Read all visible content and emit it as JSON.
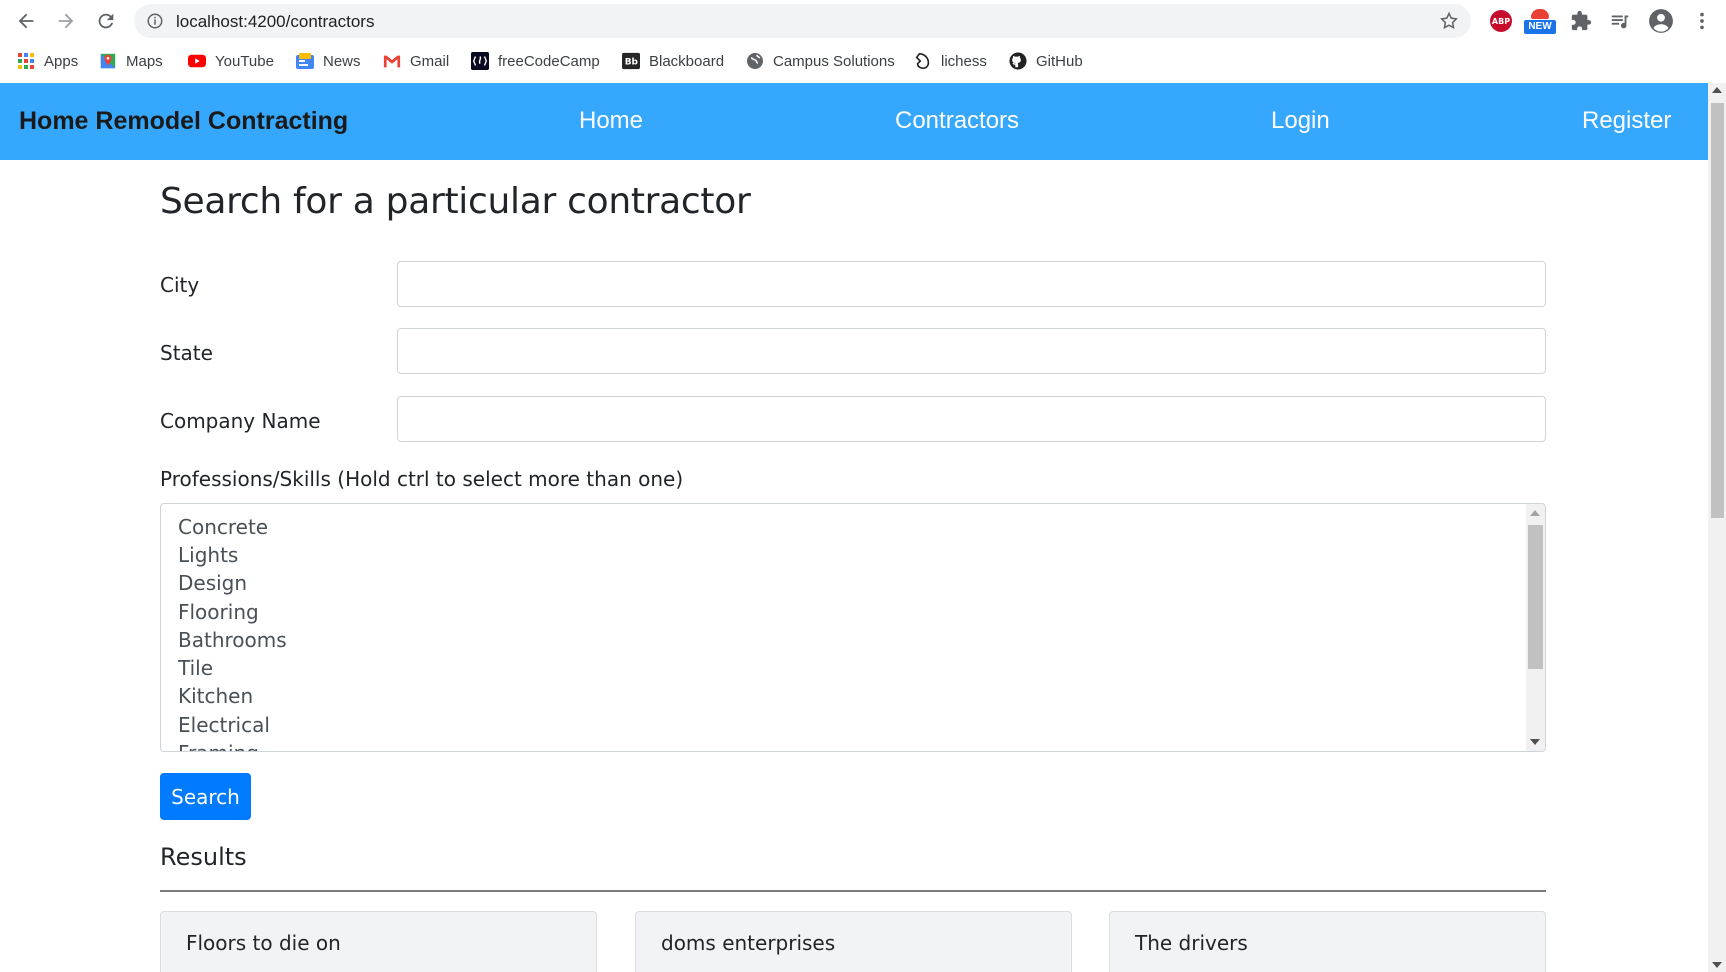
{
  "browser": {
    "url": "localhost:4200/contractors",
    "bookmarks": [
      {
        "label": "Apps",
        "icon": "apps-grid-icon"
      },
      {
        "label": "Maps",
        "icon": "maps-icon"
      },
      {
        "label": "YouTube",
        "icon": "youtube-icon"
      },
      {
        "label": "News",
        "icon": "news-icon"
      },
      {
        "label": "Gmail",
        "icon": "gmail-icon"
      },
      {
        "label": "freeCodeCamp",
        "icon": "freecodecamp-icon"
      },
      {
        "label": "Blackboard",
        "icon": "blackboard-icon"
      },
      {
        "label": "Campus Solutions",
        "icon": "globe-icon"
      },
      {
        "label": "lichess",
        "icon": "lichess-icon"
      },
      {
        "label": "GitHub",
        "icon": "github-icon"
      }
    ],
    "extensions": {
      "abp": "ABP",
      "new_badge": "NEW"
    }
  },
  "navbar": {
    "brand": "Home Remodel Contracting",
    "links": [
      "Home",
      "Contractors",
      "Login",
      "Register"
    ],
    "bg_color": "#35a7fc"
  },
  "form": {
    "title": "Search for a particular contractor",
    "city_label": "City",
    "city_value": "",
    "state_label": "State",
    "state_value": "",
    "company_label": "Company Name",
    "company_value": "",
    "skills_label": "Professions/Skills (Hold ctrl to select more than one)",
    "skills_options": [
      "Concrete",
      "Lights",
      "Design",
      "Flooring",
      "Bathrooms",
      "Tile",
      "Kitchen",
      "Electrical",
      "Framing"
    ],
    "search_button": "Search",
    "button_color": "#007bff"
  },
  "results": {
    "heading": "Results",
    "cards": [
      "Floors to die on",
      "doms enterprises",
      "The drivers"
    ]
  }
}
